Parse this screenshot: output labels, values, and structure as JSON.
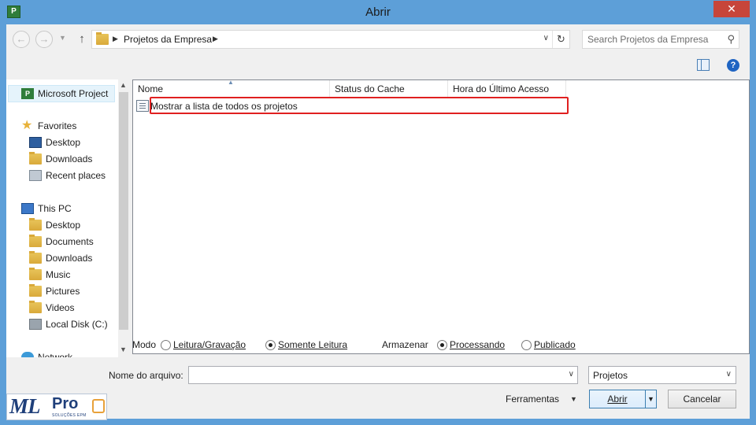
{
  "window": {
    "title": "Abrir",
    "close_glyph": "✕",
    "app_icon": "P"
  },
  "address": {
    "breadcrumb": "Projetos da Empresa",
    "search_placeholder": "Search Projetos da Empresa"
  },
  "nav": {
    "project": "Microsoft Project",
    "favorites": "Favorites",
    "fav_items": [
      "Desktop",
      "Downloads",
      "Recent places"
    ],
    "thispc": "This PC",
    "pc_items": [
      "Desktop",
      "Documents",
      "Downloads",
      "Music",
      "Pictures",
      "Videos",
      "Local Disk (C:)"
    ],
    "network": "Network"
  },
  "filelist": {
    "columns": [
      "Nome",
      "Status do Cache",
      "Hora do Último Acesso"
    ],
    "rows": [
      {
        "name": "Mostrar a lista de todos os projetos"
      }
    ]
  },
  "options": {
    "mode_label": "Modo",
    "mode_rw": "Leitura/Gravação",
    "mode_ro": "Somente Leitura",
    "mode_selected": "Somente Leitura",
    "store_label": "Armazenar",
    "store_processing": "Processando",
    "store_published": "Publicado",
    "store_selected": "Processando"
  },
  "filename": {
    "label": "Nome do arquivo:",
    "value": ""
  },
  "filetype": {
    "value": "Projetos"
  },
  "buttons": {
    "tools": "Ferramentas",
    "open": "Abrir",
    "cancel": "Cancelar"
  },
  "logo": {
    "text_ml": "ML",
    "text_pro": "Pro",
    "tagline": "SOLUÇÕES EPM"
  },
  "colors": {
    "titlebar": "#5d9fd8",
    "close": "#c7453a",
    "highlight": "#e02020",
    "selected_nav": "#e5f3fb"
  }
}
